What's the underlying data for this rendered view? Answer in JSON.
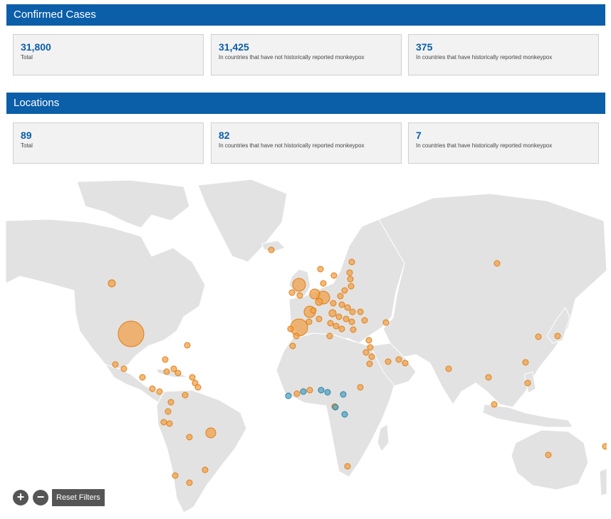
{
  "confirmed": {
    "title": "Confirmed Cases",
    "cards": [
      {
        "value": "31,800",
        "caption": "Total"
      },
      {
        "value": "31,425",
        "caption": "In countries that have not historically reported monkeypox"
      },
      {
        "value": "375",
        "caption": "In countries that have historically reported monkeypox"
      }
    ]
  },
  "locations": {
    "title": "Locations",
    "cards": [
      {
        "value": "89",
        "caption": "Total"
      },
      {
        "value": "82",
        "caption": "In countries that have not historically reported monkeypox"
      },
      {
        "value": "7",
        "caption": "In countries that have historically reported monkeypox"
      }
    ]
  },
  "map": {
    "colors": {
      "land": "#e2e2e2",
      "non_historical": "#f0a24b",
      "historical": "#4ea6c5",
      "header": "#0b5ea8"
    },
    "controls": {
      "zoom_in_icon": "plus-icon",
      "zoom_out_icon": "minus-icon",
      "zoom_in": "+",
      "zoom_out": "−",
      "reset_label": "Reset Filters"
    }
  }
}
